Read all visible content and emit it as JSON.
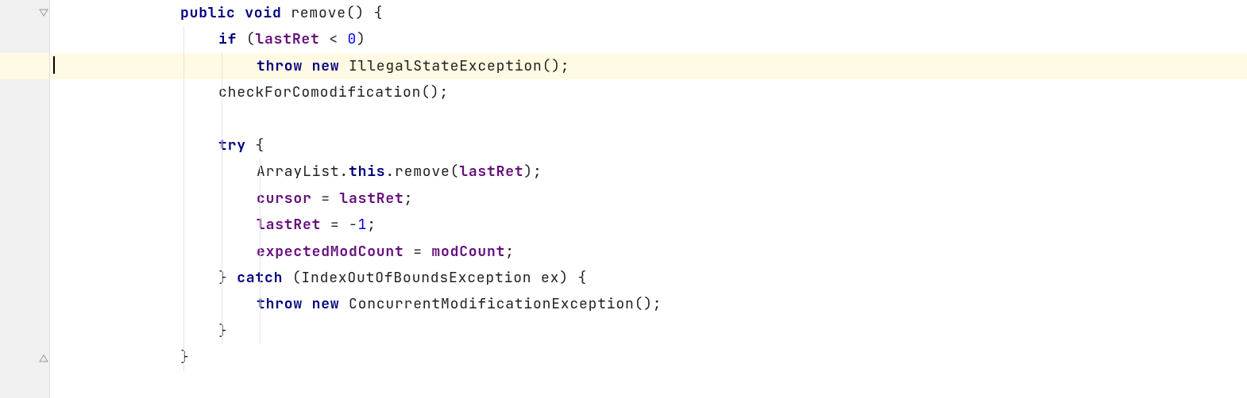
{
  "editor": {
    "caret_line_index": 2,
    "lines": [
      {
        "indent": 8,
        "tokens": [
          {
            "t": "public ",
            "c": "kw"
          },
          {
            "t": "void ",
            "c": "kw"
          },
          {
            "t": "remove() {",
            "c": "plain"
          }
        ]
      },
      {
        "indent": 12,
        "tokens": [
          {
            "t": "if ",
            "c": "kw"
          },
          {
            "t": "(",
            "c": "plain"
          },
          {
            "t": "lastRet ",
            "c": "mem"
          },
          {
            "t": "< ",
            "c": "plain"
          },
          {
            "t": "0",
            "c": "num"
          },
          {
            "t": ")",
            "c": "plain"
          }
        ]
      },
      {
        "indent": 16,
        "highlight": true,
        "tokens": [
          {
            "t": "throw new ",
            "c": "kw"
          },
          {
            "t": "IllegalStateException();",
            "c": "plain"
          }
        ]
      },
      {
        "indent": 12,
        "tokens": [
          {
            "t": "checkForComodification();",
            "c": "plain"
          }
        ]
      },
      {
        "indent": 0,
        "tokens": []
      },
      {
        "indent": 12,
        "tokens": [
          {
            "t": "try ",
            "c": "kw"
          },
          {
            "t": "{",
            "c": "plain"
          }
        ]
      },
      {
        "indent": 16,
        "tokens": [
          {
            "t": "ArrayList.",
            "c": "plain"
          },
          {
            "t": "this",
            "c": "this"
          },
          {
            "t": ".remove(",
            "c": "plain"
          },
          {
            "t": "lastRet",
            "c": "mem"
          },
          {
            "t": ");",
            "c": "plain"
          }
        ]
      },
      {
        "indent": 16,
        "tokens": [
          {
            "t": "cursor ",
            "c": "mem"
          },
          {
            "t": "= ",
            "c": "plain"
          },
          {
            "t": "lastRet",
            "c": "mem"
          },
          {
            "t": ";",
            "c": "plain"
          }
        ]
      },
      {
        "indent": 16,
        "tokens": [
          {
            "t": "lastRet ",
            "c": "mem"
          },
          {
            "t": "= -",
            "c": "plain"
          },
          {
            "t": "1",
            "c": "num"
          },
          {
            "t": ";",
            "c": "plain"
          }
        ]
      },
      {
        "indent": 16,
        "tokens": [
          {
            "t": "expectedModCount ",
            "c": "mem"
          },
          {
            "t": "= ",
            "c": "plain"
          },
          {
            "t": "modCount",
            "c": "mem"
          },
          {
            "t": ";",
            "c": "plain"
          }
        ]
      },
      {
        "indent": 12,
        "tokens": [
          {
            "t": "} ",
            "c": "plain"
          },
          {
            "t": "catch ",
            "c": "kw"
          },
          {
            "t": "(IndexOutOfBoundsException ex) {",
            "c": "plain"
          }
        ]
      },
      {
        "indent": 16,
        "tokens": [
          {
            "t": "throw new ",
            "c": "kw"
          },
          {
            "t": "ConcurrentModificationException();",
            "c": "plain"
          }
        ]
      },
      {
        "indent": 12,
        "tokens": [
          {
            "t": "}",
            "c": "plain"
          }
        ]
      },
      {
        "indent": 8,
        "tokens": [
          {
            "t": "}",
            "c": "plain"
          }
        ]
      }
    ],
    "fold_markers": [
      {
        "line": 0,
        "kind": "start"
      },
      {
        "line": 13,
        "kind": "end"
      }
    ],
    "indent_guides_cols": [
      8,
      12,
      16
    ],
    "guide_rows": {
      "8": {
        "from": 1,
        "to": 13
      },
      "12": {
        "from": 2,
        "to": 12
      },
      "16": {
        "from": 6,
        "to": 12
      }
    }
  }
}
